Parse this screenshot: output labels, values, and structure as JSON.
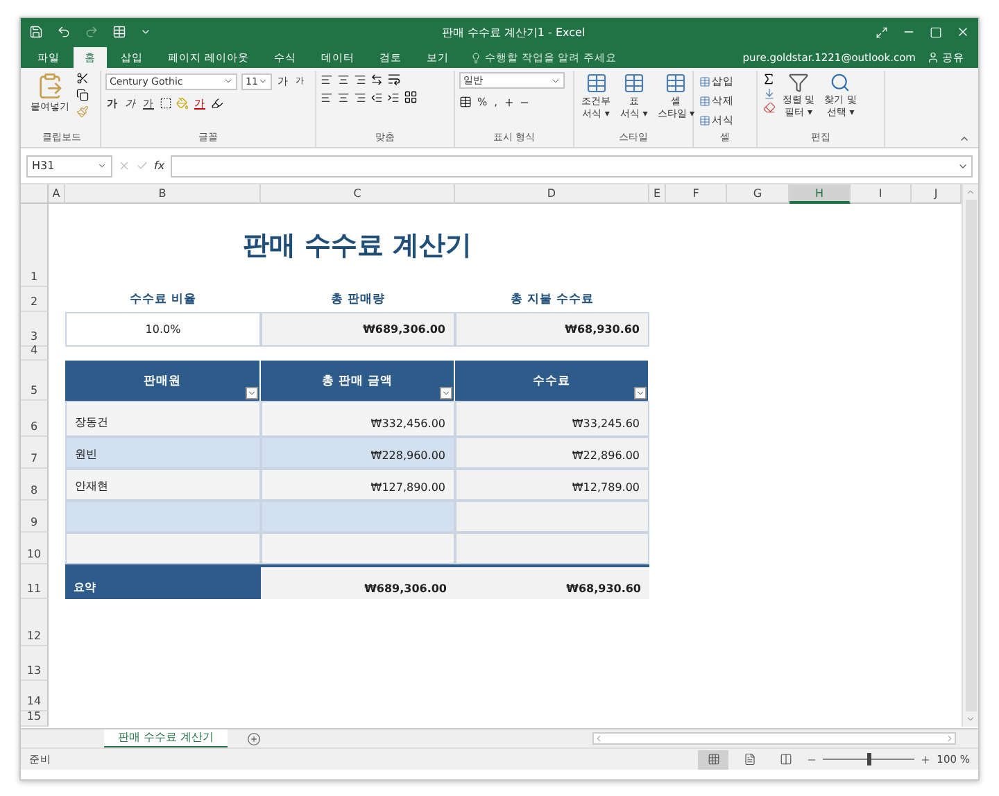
{
  "window": {
    "title": "판매 수수료 계산기1 - Excel"
  },
  "menu_tabs": [
    {
      "label": "파일",
      "selected": false
    },
    {
      "label": "홈",
      "selected": true
    },
    {
      "label": "삽입",
      "selected": false
    },
    {
      "label": "페이지 레이아웃",
      "selected": false
    },
    {
      "label": "수식",
      "selected": false
    },
    {
      "label": "데이터",
      "selected": false
    },
    {
      "label": "검토",
      "selected": false
    },
    {
      "label": "보기",
      "selected": false
    }
  ],
  "tell_me": {
    "placeholder": "수행할 작업을 알려 주세요"
  },
  "account": "pure.goldstar.1221@outlook.com",
  "share": "공유",
  "ribbon": {
    "clipboard": {
      "paste": "붙여넣기",
      "label": "클립보드"
    },
    "font": {
      "name": "Century Gothic",
      "size": "11",
      "grow": "가",
      "shrink": "가",
      "bold": "가",
      "italic": "가",
      "underline": "가",
      "color_button": "가",
      "label": "글꼴"
    },
    "alignment": {
      "label": "맞춤"
    },
    "number": {
      "format": "일반",
      "percent": "%",
      "comma": ",",
      "label": "표시 형식"
    },
    "styles": {
      "buttons": [
        {
          "line1": "조건부",
          "line2": "서식 ▾"
        },
        {
          "line1": "표",
          "line2": "서식 ▾"
        },
        {
          "line1": "셀",
          "line2": "스타일 ▾"
        }
      ],
      "label": "스타일"
    },
    "cells": {
      "buttons": [
        "삽입",
        "삭제",
        "서식"
      ],
      "label": "셀"
    },
    "editing": {
      "buttons": [
        {
          "line1": "정렬 및",
          "line2": "필터 ▾"
        },
        {
          "line1": "찾기 및",
          "line2": "선택 ▾"
        }
      ],
      "label": "편집"
    }
  },
  "formula_bar": {
    "name_box": "H31",
    "formula": "fx"
  },
  "columns": [
    {
      "label": "A",
      "selected": false
    },
    {
      "label": "B",
      "selected": false
    },
    {
      "label": "C",
      "selected": false
    },
    {
      "label": "D",
      "selected": false
    },
    {
      "label": "E",
      "selected": false
    },
    {
      "label": "F",
      "selected": false
    },
    {
      "label": "G",
      "selected": false
    },
    {
      "label": "H",
      "selected": true
    },
    {
      "label": "I",
      "selected": false
    },
    {
      "label": "J",
      "selected": false
    }
  ],
  "row_numbers": [
    "1",
    "2",
    "3",
    "4",
    "5",
    "6",
    "7",
    "8",
    "9",
    "10",
    "11",
    "12",
    "13",
    "14",
    "15"
  ],
  "sheet": {
    "title": "판매 수수료 계산기",
    "summary_labels": [
      "수수료 비율",
      "총 판매량",
      "총 지불 수수료"
    ],
    "summary_values": [
      "10.0%",
      "₩689,306.00",
      "₩68,930.60"
    ],
    "table_headers": [
      "판매원",
      "총 판매 금액",
      "수수료"
    ],
    "rows": [
      {
        "banded": false,
        "name": "장동건",
        "total": "₩332,456.00",
        "commission": "₩33,245.60"
      },
      {
        "banded": true,
        "name": "원빈",
        "total": "₩228,960.00",
        "commission": "₩22,896.00"
      },
      {
        "banded": false,
        "name": "안재현",
        "total": "₩127,890.00",
        "commission": "₩12,789.00"
      },
      {
        "banded": true
      },
      {
        "banded": false
      }
    ],
    "total": {
      "label": "요약",
      "total": "₩689,306.00",
      "commission": "₩68,930.60"
    }
  },
  "sheet_tabs": [
    {
      "label": "판매 수수료 계산기",
      "selected": true
    }
  ],
  "status_bar": {
    "mode": "준비",
    "views": [
      {
        "kind": "normal",
        "selected": true
      },
      {
        "kind": "page_layout",
        "selected": false
      },
      {
        "kind": "page_break",
        "selected": false
      }
    ],
    "zoom_slider": {
      "level": 0.5
    },
    "zoom": "100 %"
  }
}
